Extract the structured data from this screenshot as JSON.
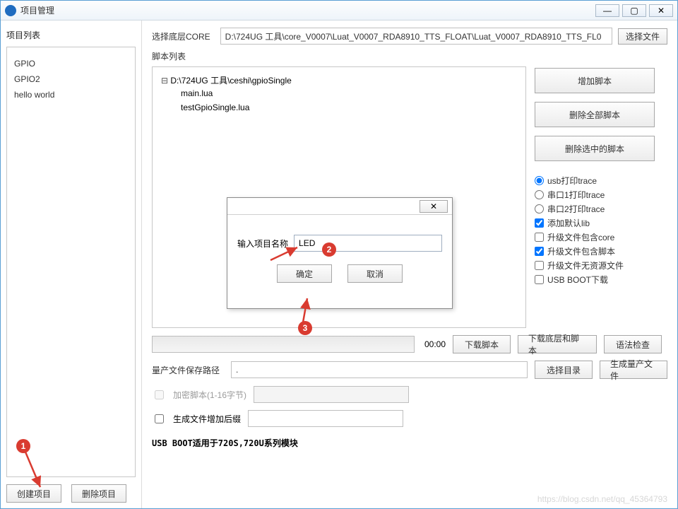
{
  "title": "项目管理",
  "win_controls": {
    "min": "—",
    "max": "▢",
    "close": "✕"
  },
  "left": {
    "heading": "项目列表",
    "items": [
      "GPIO",
      "GPIO2",
      "hello world"
    ],
    "create_btn": "创建项目",
    "delete_btn": "删除项目"
  },
  "core": {
    "label": "选择底层CORE",
    "path": "D:\\724UG 工具\\core_V0007\\Luat_V0007_RDA8910_TTS_FLOAT\\Luat_V0007_RDA8910_TTS_FL0",
    "choose_btn": "选择文件"
  },
  "scripts": {
    "heading": "脚本列表",
    "root": "D:\\724UG 工具\\ceshi\\gpioSingle",
    "children": [
      "main.lua",
      "testGpioSingle.lua"
    ]
  },
  "side": {
    "add": "增加脚本",
    "delete_all": "删除全部脚本",
    "delete_sel": "删除选中的脚本",
    "radios": {
      "usb": "usb打印trace",
      "serial1": "串口1打印trace",
      "serial2": "串口2打印trace"
    },
    "checks": {
      "add_lib": "添加默认lib",
      "upgrade_core": "升级文件包含core",
      "upgrade_script": "升级文件包含脚本",
      "upgrade_nores": "升级文件无资源文件",
      "usb_boot": "USB BOOT下载"
    }
  },
  "progress_time": "00:00",
  "dl_script": "下载脚本",
  "dl_both": "下载底层和脚本",
  "syntax": "语法检查",
  "mass": {
    "label": "量产文件保存路径",
    "path": ".",
    "choose": "选择目录",
    "gen": "生成量产文件"
  },
  "encrypt_label": "加密脚本(1-16字节)",
  "gen_suffix_label": "生成文件增加后缀",
  "boot_msg": "USB BOOT适用于720S,720U系列模块",
  "dialog": {
    "label": "输入项目名称",
    "value": "LED",
    "ok": "确定",
    "cancel": "取消",
    "close": "✕"
  },
  "markers": {
    "m1": "1",
    "m2": "2",
    "m3": "3"
  },
  "watermark": "https://blog.csdn.net/qq_45364793"
}
